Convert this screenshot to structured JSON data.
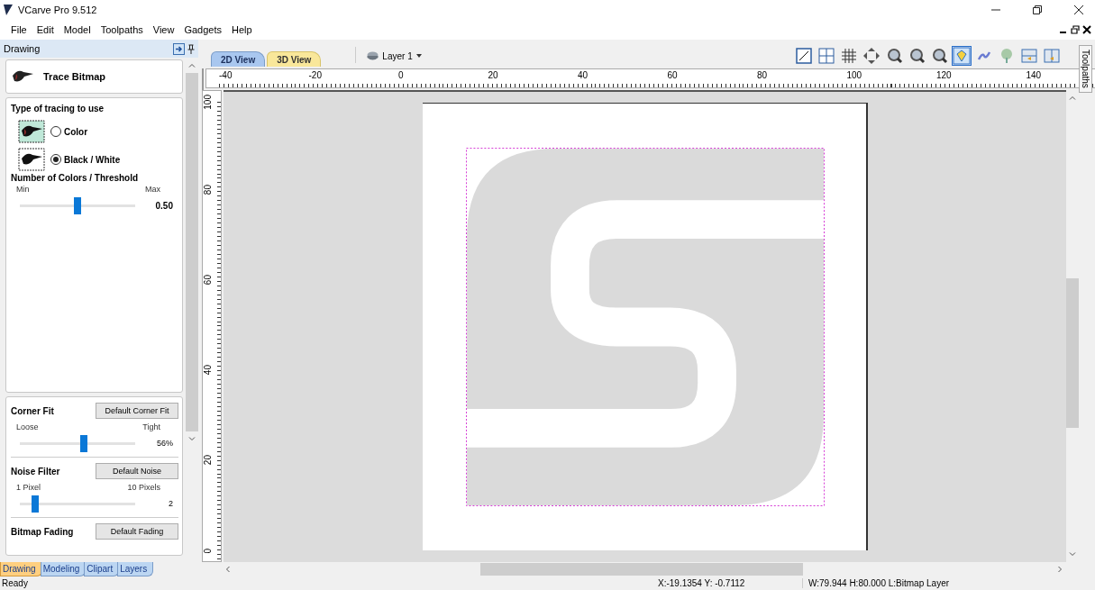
{
  "window": {
    "title": "VCarve Pro 9.512"
  },
  "menu": [
    "File",
    "Edit",
    "Model",
    "Toolpaths",
    "View",
    "Gadgets",
    "Help"
  ],
  "panel": {
    "title": "Drawing",
    "form_title": "Trace Bitmap",
    "tracing": {
      "heading": "Type of tracing to use",
      "options": [
        {
          "label": "Color",
          "selected": false,
          "kind": "color"
        },
        {
          "label": "Black / White",
          "selected": true,
          "kind": "mono"
        }
      ]
    },
    "threshold": {
      "heading": "Number of Colors / Threshold",
      "min_label": "Min",
      "max_label": "Max",
      "level": 0.5,
      "reading": "0.50"
    },
    "corner_fit": {
      "heading": "Corner Fit",
      "button": "Default Corner Fit",
      "min_label": "Loose",
      "max_label": "Tight",
      "level": 0.56,
      "reading": "56%"
    },
    "noise_filter": {
      "heading": "Noise Filter",
      "button": "Default Noise",
      "min_label": "1 Pixel",
      "max_label": "10 Pixels",
      "level": 0.11,
      "reading": "2"
    },
    "bitmap_fading": {
      "heading": "Bitmap Fading",
      "button": "Default Fading"
    },
    "tabs": [
      {
        "label": "Drawing",
        "selected": true
      },
      {
        "label": "Modeling",
        "selected": false
      },
      {
        "label": "Clipart",
        "selected": false
      },
      {
        "label": "Layers",
        "selected": false
      }
    ]
  },
  "view_tabs": [
    {
      "label": "2D View",
      "selected": true
    },
    {
      "label": "3D View",
      "selected": false
    }
  ],
  "layer": {
    "label": "Layer 1"
  },
  "ruler": {
    "x_labels": [
      "-40",
      "-20",
      "0",
      "20",
      "40",
      "60",
      "80",
      "100",
      "120",
      "140"
    ],
    "y_labels": [
      "100",
      "80",
      "60",
      "40",
      "20",
      "0"
    ]
  },
  "side_tab": {
    "label": "Toolpaths"
  },
  "status_bar": {
    "message": "Ready",
    "cursor": "X:-19.1354 Y: -0.7112",
    "selection": "W:79.944  H:80.000  L:Bitmap Layer"
  }
}
